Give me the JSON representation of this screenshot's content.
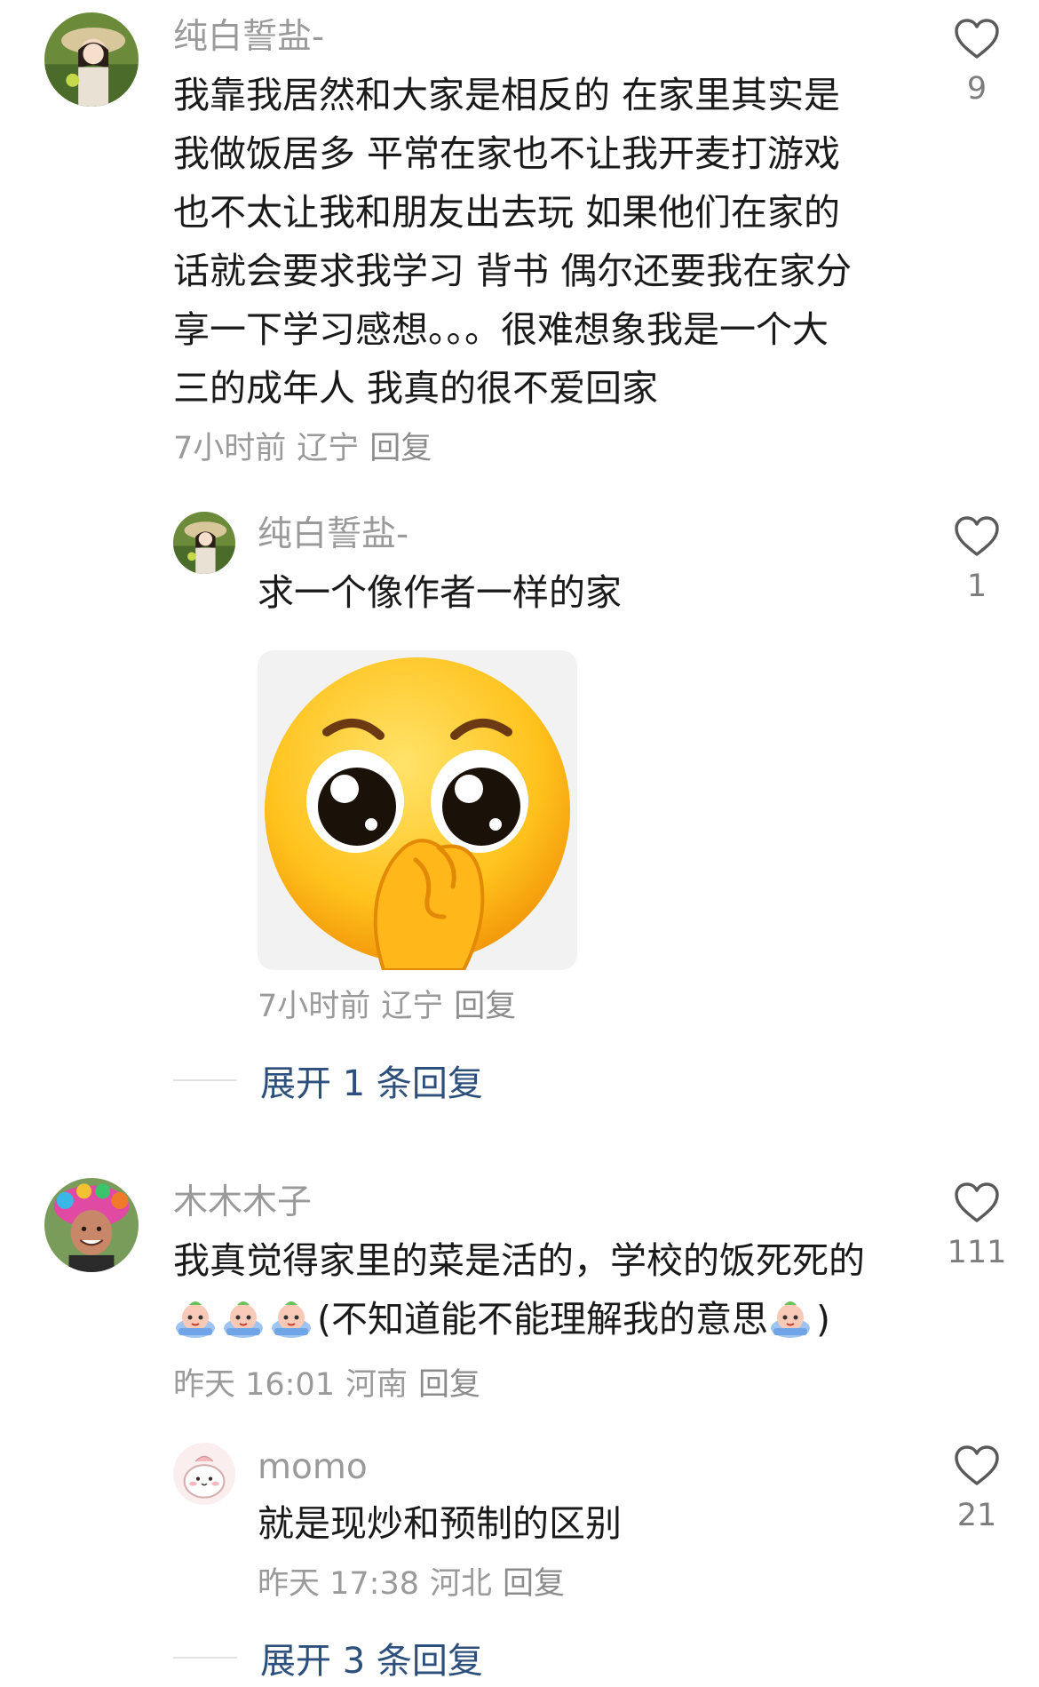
{
  "comments": [
    {
      "username": "纯白誓盐-",
      "lines": [
        "我靠我居然和大家是相反的 在家里其实是",
        "我做饭居多 平常在家也不让我开麦打游戏",
        "也不太让我和朋友出去玩 如果他们在家的",
        "话就会要求我学习 背书 偶尔还要我在家分",
        "享一下学习感想。。。很难想象我是一个大",
        "三的成年人 我真的很不爱回家"
      ],
      "time": "7小时前",
      "location": "辽宁",
      "reply_label": "回复",
      "likes": "9",
      "replies": [
        {
          "username": "纯白誓盐-",
          "text": "求一个像作者一样的家",
          "sticker": "pleading-face-sticker",
          "time": "7小时前",
          "location": "辽宁",
          "reply_label": "回复",
          "likes": "1"
        }
      ],
      "expand_label": "展开 1 条回复"
    },
    {
      "username": "木木木子",
      "line1": "我真觉得家里的菜是活的，学校的饭死死的",
      "line2_text": "(不知道能不能理解我的意思",
      "line2_close": ")",
      "inline_emoji": "crying-hug-emoji",
      "time": "昨天 16:01",
      "location": "河南",
      "reply_label": "回复",
      "likes": "111",
      "replies": [
        {
          "username": "momo",
          "text": "就是现炒和预制的区别",
          "time": "昨天 17:38",
          "location": "河北",
          "reply_label": "回复",
          "likes": "21"
        }
      ],
      "expand_label": "展开 3 条回复"
    }
  ],
  "colors": {
    "username": "#9a9a9a",
    "body_text": "#1a1a1a",
    "meta": "#9a9a9a",
    "expand_link": "#2d4f7c",
    "like_icon": "#5a5a5a"
  }
}
